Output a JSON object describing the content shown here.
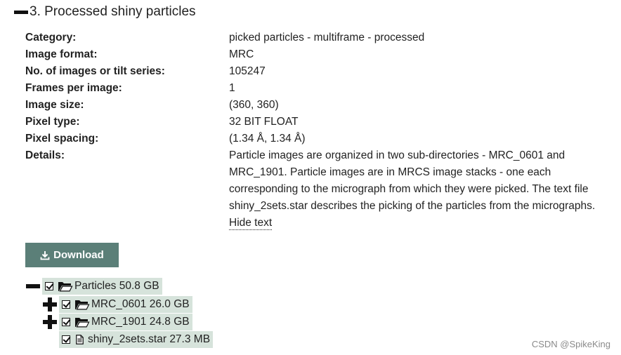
{
  "section": {
    "title": "3. Processed shiny particles"
  },
  "meta": [
    {
      "label": "Category:",
      "value": "picked particles - multiframe - processed"
    },
    {
      "label": "Image format:",
      "value": "MRC"
    },
    {
      "label": "No. of images or tilt series:",
      "value": "105247"
    },
    {
      "label": "Frames per image:",
      "value": "1"
    },
    {
      "label": "Image size:",
      "value": "(360, 360)"
    },
    {
      "label": "Pixel type:",
      "value": "32 BIT FLOAT"
    },
    {
      "label": "Pixel spacing:",
      "value": "(1.34 Å, 1.34 Å)"
    },
    {
      "label": "Details:",
      "value": "Particle images are organized in two sub-directories - MRC_0601 and MRC_1901. Particle images are in MRCS image stacks - one each corresponding to the micrograph from which they were picked. The text file shiny_2sets.star describes the picking of the particles from the micrographs."
    }
  ],
  "hide_text_link": "Hide text",
  "download": {
    "label": "Download",
    "icon": "download-icon"
  },
  "tree": [
    {
      "name": "Particles",
      "size": "50.8 GB",
      "toggle": "collapse",
      "checked": true,
      "kind": "folder"
    },
    {
      "name": "MRC_0601",
      "size": "26.0 GB",
      "toggle": "expand",
      "checked": true,
      "kind": "folder"
    },
    {
      "name": "MRC_1901",
      "size": "24.8 GB",
      "toggle": "expand",
      "checked": true,
      "kind": "folder"
    },
    {
      "name": "shiny_2sets.star",
      "size": "27.3 MB",
      "toggle": "none",
      "checked": true,
      "kind": "file"
    }
  ],
  "watermark": "CSDN @SpikeKing",
  "colors": {
    "download_bg": "#5b7f78",
    "tree_node_bg": "#d6e3db"
  }
}
